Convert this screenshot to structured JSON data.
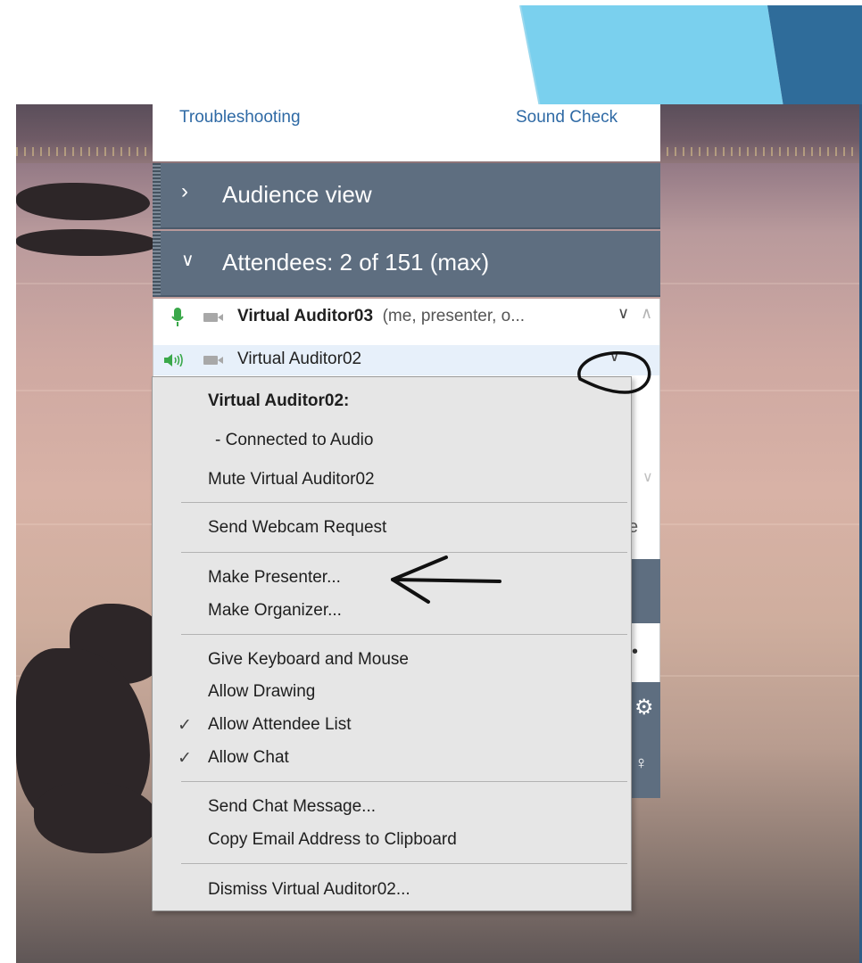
{
  "links": {
    "troubleshooting": "Troubleshooting",
    "sound_check": "Sound Check"
  },
  "sections": {
    "audience_view": "Audience view",
    "attendees": "Attendees:  2 of 151 (max)"
  },
  "attendees": [
    {
      "name": "Virtual Auditor03",
      "role": "(me, presenter, o...",
      "audio": "microphone",
      "audio_color": "#3aa84a"
    },
    {
      "name": "Virtual Auditor02",
      "role": "",
      "audio": "speaker",
      "audio_color": "#3aa84a"
    }
  ],
  "menu": {
    "header": "Virtual Auditor02:",
    "status": "- Connected to Audio",
    "mute": "Mute Virtual Auditor02",
    "send_webcam": "Send Webcam Request",
    "make_presenter": "Make Presenter...",
    "make_organizer": "Make Organizer...",
    "give_keyboard": "Give Keyboard and Mouse",
    "allow_drawing": "Allow Drawing",
    "allow_attendee_list": "Allow Attendee List",
    "allow_chat": "Allow Chat",
    "send_chat": "Send Chat Message...",
    "copy_email": "Copy Email Address to Clipboard",
    "dismiss": "Dismiss Virtual Auditor02..."
  },
  "peek_letter": "e",
  "colors": {
    "panel_header": "#5e6e80",
    "link": "#2f6aa5",
    "slide_accent_light": "#7ad0ee",
    "slide_accent_dark": "#2f6c9a"
  }
}
